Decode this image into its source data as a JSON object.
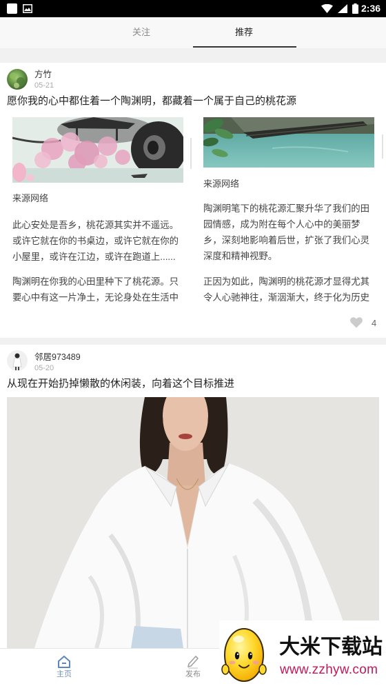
{
  "status_bar": {
    "time": "2:36",
    "icons": [
      "notification-icon",
      "gallery-icon",
      "wifi-icon",
      "signal-icon",
      "battery-icon"
    ]
  },
  "tabs": [
    {
      "label": "关注",
      "active": false
    },
    {
      "label": "推荐",
      "active": true
    }
  ],
  "feed": [
    {
      "author": "方竹",
      "date": "05-21",
      "title": "愿你我的心中都住着一个陶渊明，都藏着一个属于自己的桃花源",
      "panels": [
        {
          "source": "来源网络",
          "paragraphs": [
            "此心安处是吾乡，桃花源其实并不遥远。或许它就在你的书桌边，或许它就在你的小屋里，或许在江边，或许在跑道上......",
            "陶渊明在你我的心田里种下了桃花源。只要心中有这一片净土，无论身处在生活中"
          ]
        },
        {
          "source": "来源网络",
          "paragraphs": [
            "陶渊明笔下的桃花源汇聚升华了我们的田园情感，成为附在每个人心中的美丽梦乡，深刻地影响着后世，扩张了我们心灵深度和精神视野。",
            "正因为如此，陶渊明的桃花源才显得尤其令人心驰神往，渐洇渐大，终于化为历史"
          ]
        }
      ],
      "likes": "4",
      "like_icon": "heart-icon"
    },
    {
      "author": "邻居973489",
      "date": "05-20",
      "title": "从现在开始扔掉懒散的休闲装，向着这个目标推进"
    }
  ],
  "bottom_nav": [
    {
      "label": "主页",
      "icon": "home-icon",
      "active": true
    },
    {
      "label": "发布",
      "icon": "pencil-icon",
      "active": false
    }
  ],
  "watermark": {
    "name": "大米下载站",
    "url": "www.zzhyw.com"
  },
  "colors": {
    "status_bar": "#000000",
    "background": "#f1f1f1",
    "card": "#ffffff",
    "active_tab_underline": "#333333",
    "nav_active": "#5b86c4",
    "like_icon": "#cccccc"
  }
}
